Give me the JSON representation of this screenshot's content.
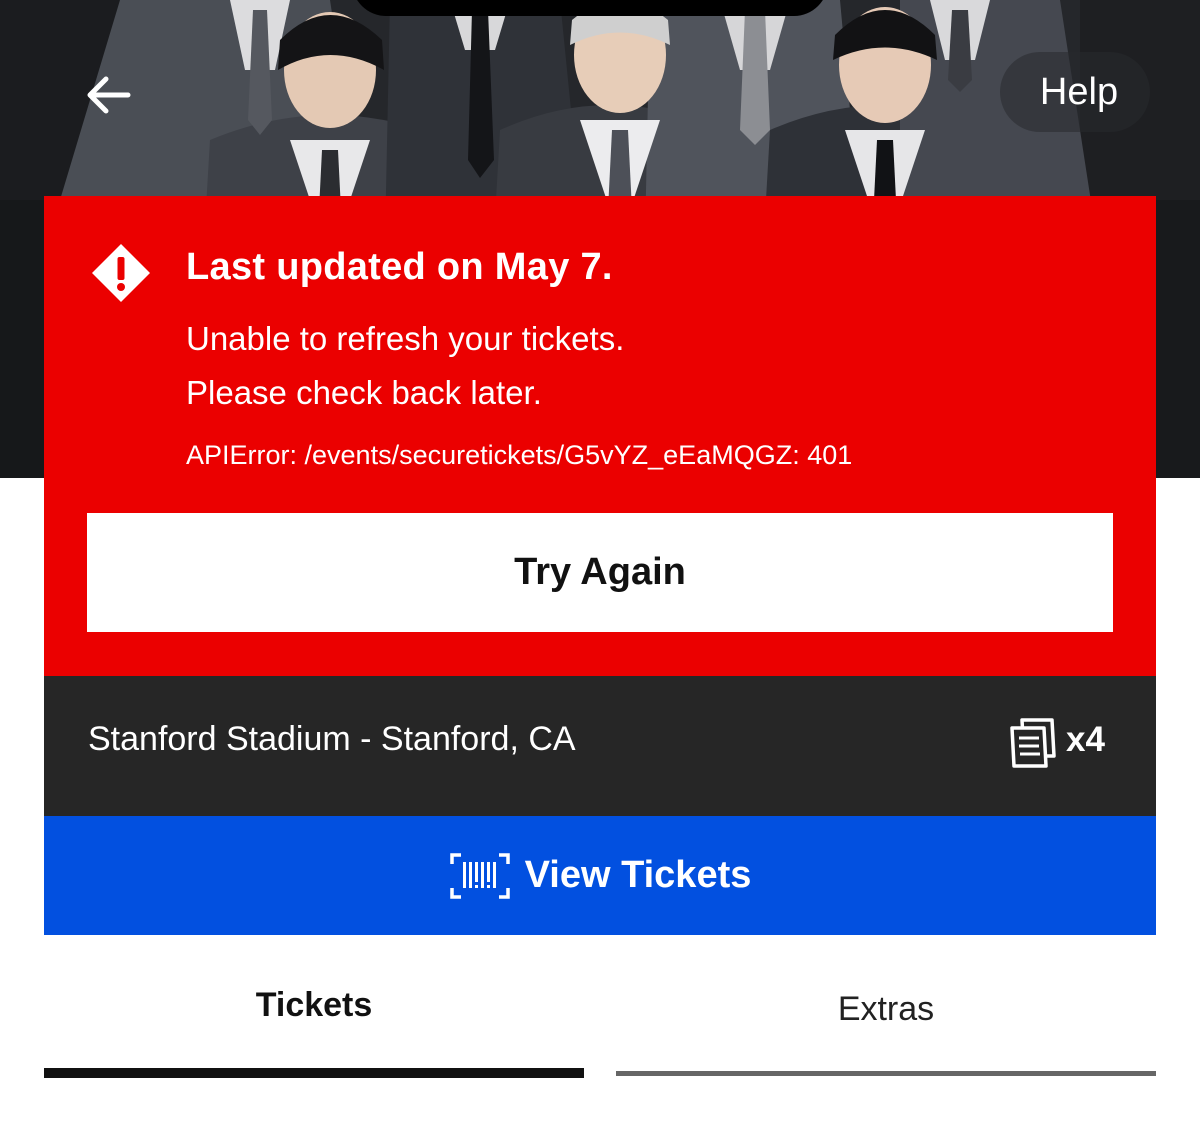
{
  "header": {
    "back_icon": "arrow-left-icon",
    "help_label": "Help"
  },
  "error": {
    "icon": "warning-diamond-icon",
    "title": "Last updated on May 7.",
    "line1": "Unable to refresh your tickets.",
    "line2": "Please check back later.",
    "code": "APIError: /events/securetickets/G5vYZ_eEaMQGZ: 401",
    "retry_label": "Try Again",
    "color": "#eb0000"
  },
  "venue": {
    "name": "Stanford Stadium - Stanford, CA",
    "ticket_icon": "tickets-stack-icon",
    "ticket_count": "x4",
    "bar_color": "#262626"
  },
  "view_tickets": {
    "icon": "barcode-scan-icon",
    "label": "View Tickets",
    "color": "#0250e0"
  },
  "tabs": [
    {
      "label": "Tickets",
      "active": true
    },
    {
      "label": "Extras",
      "active": false
    }
  ]
}
